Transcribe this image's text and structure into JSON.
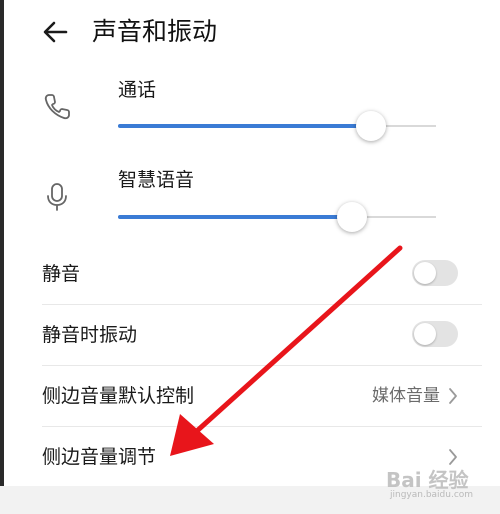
{
  "header": {
    "title": "声音和振动",
    "back_icon": "arrow-left-icon"
  },
  "volume": [
    {
      "label": "通话",
      "icon": "phone-icon",
      "level": 0.795
    },
    {
      "label": "智慧语音",
      "icon": "microphone-icon",
      "level": 0.735
    }
  ],
  "settings": [
    {
      "label": "静音",
      "type": "toggle",
      "on": false
    },
    {
      "label": "静音时振动",
      "type": "toggle",
      "on": false
    },
    {
      "label": "侧边音量默认控制",
      "type": "select",
      "value": "媒体音量"
    },
    {
      "label": "侧边音量调节",
      "type": "link"
    }
  ],
  "colors": {
    "accent": "#3a7bd5",
    "arrow": "#e8151b"
  },
  "watermark": {
    "text": "Bai 经验",
    "sub": "jingyan.baidu.com"
  }
}
